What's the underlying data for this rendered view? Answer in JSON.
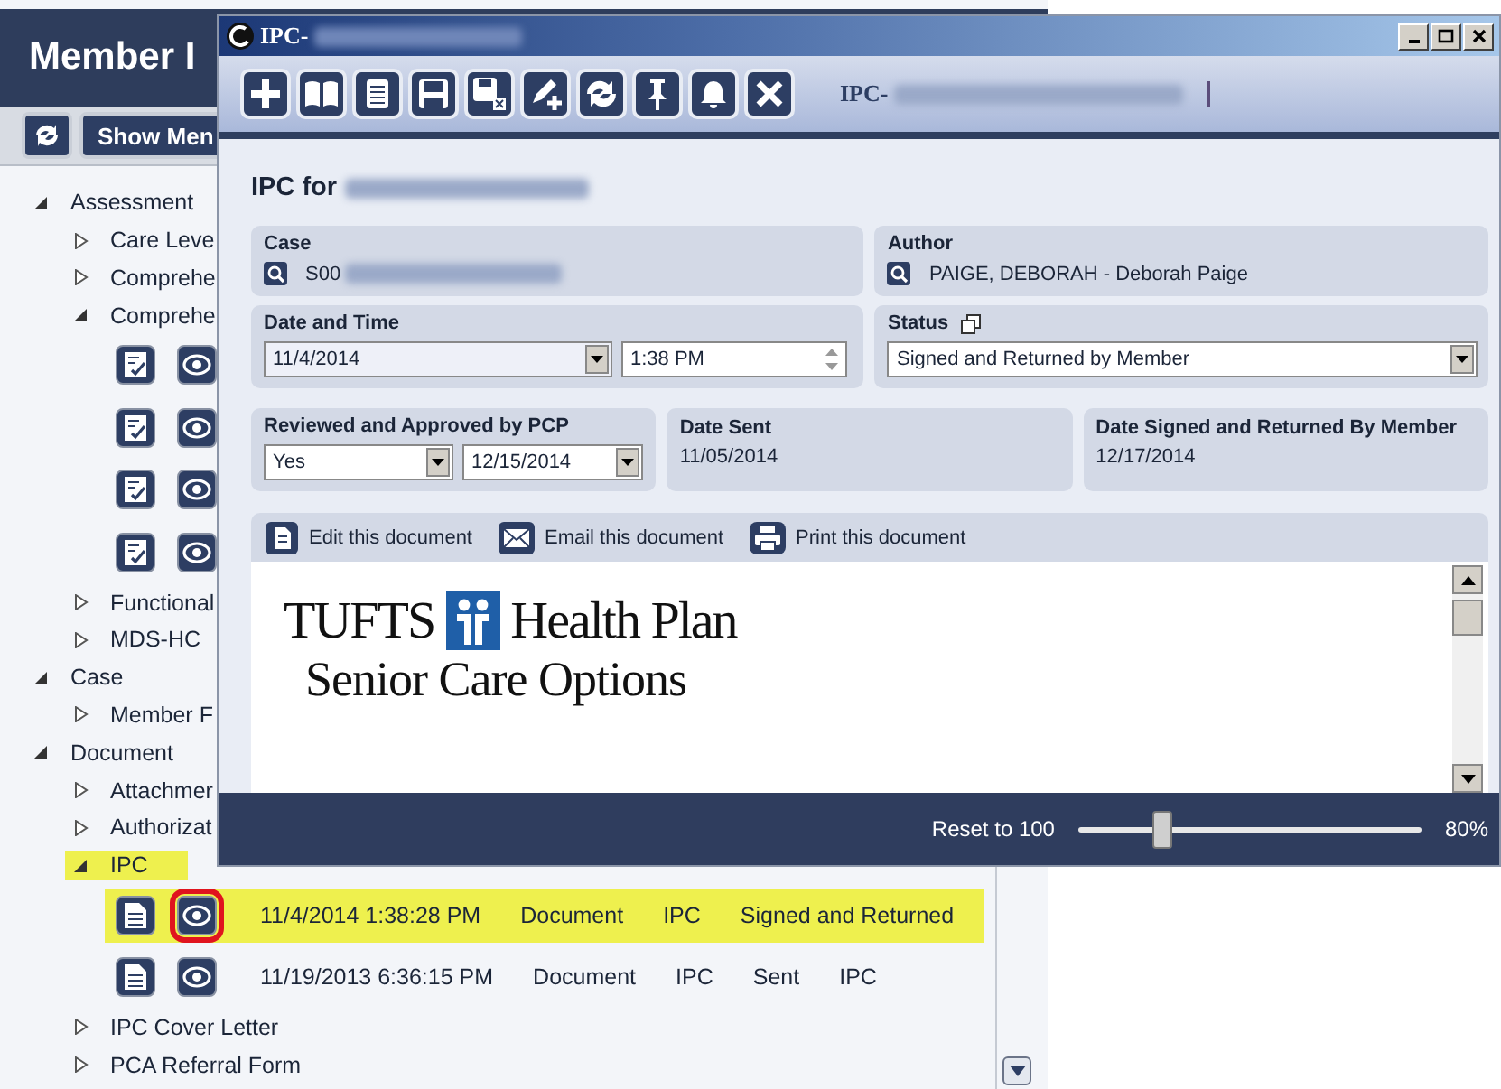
{
  "app": {
    "title": "Member I",
    "show_button": "Show Men"
  },
  "tree": [
    {
      "kind": "folder",
      "label": "Assessment",
      "expanded": true,
      "selected": false,
      "children": [
        {
          "kind": "folder",
          "label": "Care Leve",
          "expanded": false,
          "selected": false
        },
        {
          "kind": "folder",
          "label": "Comprehe",
          "expanded": false,
          "selected": false
        },
        {
          "kind": "folder",
          "label": "Comprehe",
          "expanded": true,
          "selected": false,
          "children": [
            {
              "kind": "assessment_record",
              "selected": false,
              "marked": false
            },
            {
              "kind": "assessment_record",
              "selected": false,
              "marked": false
            },
            {
              "kind": "assessment_record",
              "selected": false,
              "marked": false
            },
            {
              "kind": "assessment_record",
              "selected": false,
              "marked": false
            }
          ]
        },
        {
          "kind": "folder",
          "label": "Functional",
          "expanded": false,
          "selected": false
        },
        {
          "kind": "folder",
          "label": "MDS-HC",
          "expanded": false,
          "selected": false
        }
      ]
    },
    {
      "kind": "folder",
      "label": "Case",
      "expanded": true,
      "selected": false,
      "children": [
        {
          "kind": "folder",
          "label": "Member F",
          "expanded": false,
          "selected": false
        }
      ]
    },
    {
      "kind": "folder",
      "label": "Document",
      "expanded": true,
      "selected": false,
      "children": [
        {
          "kind": "folder",
          "label": "Attachmer",
          "expanded": false,
          "selected": false
        },
        {
          "kind": "folder",
          "label": "Authorizat",
          "expanded": false,
          "selected": false
        },
        {
          "kind": "folder",
          "label": "IPC",
          "expanded": true,
          "selected": true,
          "children": [
            {
              "kind": "document_record",
              "selected": true,
              "marked": true,
              "cells": [
                "11/4/2014 1:38:28 PM",
                "Document",
                "IPC",
                "Signed and Returned"
              ]
            },
            {
              "kind": "document_record",
              "selected": false,
              "marked": false,
              "cells": [
                "11/19/2013 6:36:15 PM",
                "Document",
                "IPC",
                "Sent",
                "IPC"
              ]
            }
          ]
        },
        {
          "kind": "folder",
          "label": "IPC Cover Letter",
          "expanded": false,
          "selected": false
        },
        {
          "kind": "folder",
          "label": "PCA Referral Form",
          "expanded": false,
          "selected": false
        }
      ]
    }
  ],
  "dialog": {
    "title": "IPC-",
    "toolbar_label": "IPC-",
    "heading": "IPC for",
    "fields": [
      {
        "kind": "lookup",
        "label": "Case",
        "value": "S00"
      },
      {
        "kind": "lookup",
        "label": "Author",
        "value": "PAIGE, DEBORAH - Deborah Paige"
      },
      {
        "kind": "datetime",
        "label": "Date and Time",
        "date": "11/4/2014",
        "time": "1:38 PM"
      },
      {
        "kind": "select",
        "label": "Status",
        "value": "Signed and Returned by Member"
      },
      {
        "kind": "select_date",
        "label": "Reviewed and Approved by PCP",
        "value": "Yes",
        "date": "12/15/2014"
      },
      {
        "kind": "text",
        "label": "Date Sent",
        "value": "11/05/2014"
      },
      {
        "kind": "text",
        "label": "Date Signed and Returned By Member",
        "value": "12/17/2014"
      }
    ],
    "actions": [
      {
        "kind": "edit",
        "label": "Edit this document"
      },
      {
        "kind": "email",
        "label": "Email this document"
      },
      {
        "kind": "print",
        "label": "Print this document"
      }
    ],
    "document": {
      "brand": "TUFTS",
      "brand_rest": "Health Plan",
      "subtitle": "Senior Care Options"
    },
    "zoom": {
      "reset": "Reset to 100",
      "level": 0.25,
      "reading": "80%"
    }
  }
}
